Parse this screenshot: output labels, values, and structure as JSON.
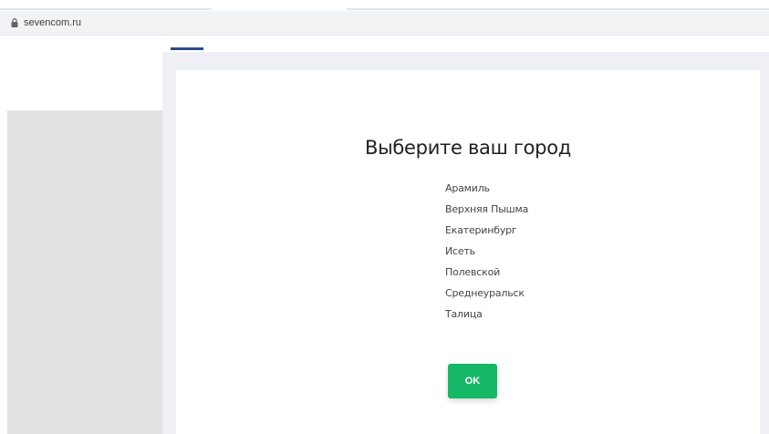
{
  "browser": {
    "url": "sevencom.ru",
    "lock_icon": "lock-icon"
  },
  "modal": {
    "title": "Выберите ваш город",
    "cities": [
      "Арамиль",
      "Верхняя Пышма",
      "Екатеринбург",
      "Исеть",
      "Полевской",
      "Среднеуральск",
      "Талица"
    ],
    "ok_label": "OK"
  },
  "colors": {
    "ok_button": "#14b866",
    "accent_bar": "#2f4a8a",
    "overlay": "#eef0f5",
    "left_block": "#e2e2e2"
  }
}
